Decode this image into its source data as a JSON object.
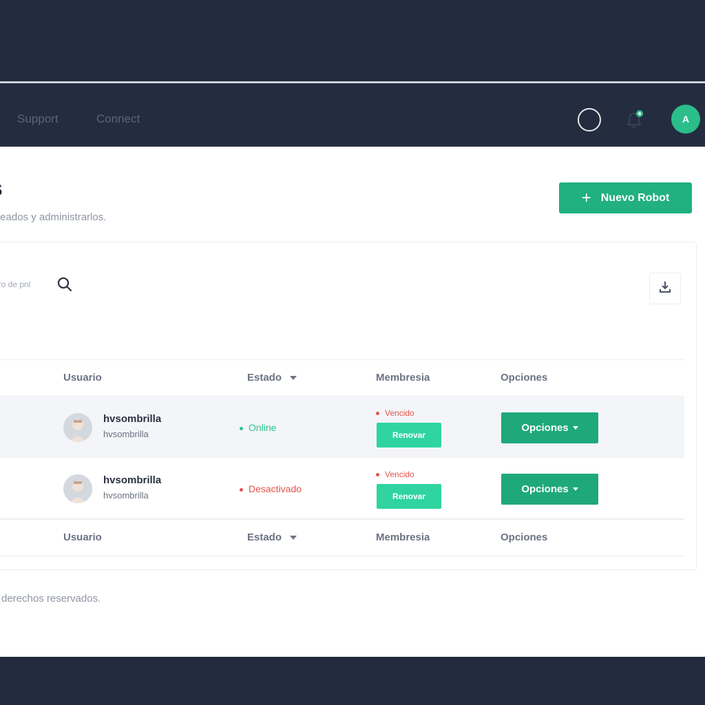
{
  "nav": {
    "links": [
      "Support",
      "Connect"
    ],
    "avatar_initial": "A",
    "icons": [
      "circle-icon",
      "bell-icon"
    ]
  },
  "header": {
    "title": "s",
    "subtitle": "s creados y administrarlos.",
    "new_button_label": "Nuevo Robot"
  },
  "search": {
    "placeholder": "ero de pnl"
  },
  "table": {
    "columns": [
      "Usuario",
      "Estado",
      "Membresia",
      "Opciones"
    ],
    "rows": [
      {
        "name": "hvsombrilla",
        "handle": "hvsombrilla",
        "status": "Online",
        "membership": "Vencido",
        "renew_label": "Renovar",
        "options_label": "Opciones"
      },
      {
        "name": "hvsombrilla",
        "handle": "hvsombrilla",
        "status": "Desactivado",
        "membership": "Vencido",
        "renew_label": "Renovar",
        "options_label": "Opciones"
      }
    ]
  },
  "footer": {
    "text": "derechos reservados."
  },
  "colors": {
    "navbar": "#242d3f",
    "accent": "#21b07f",
    "online": "#2bc48c",
    "danger": "#e5534b",
    "renew": "#2fd4a0"
  }
}
